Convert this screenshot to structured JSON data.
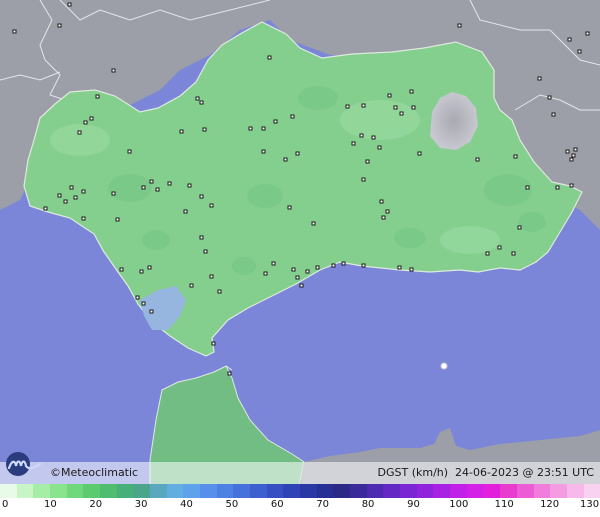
{
  "credit": {
    "symbol": "©",
    "brand": "Meteoclimatic"
  },
  "info": {
    "variable": "DGST",
    "unit": "(km/h)",
    "date": "24-06-2023",
    "sep": "@",
    "time": "23:51 UTC"
  },
  "legend": {
    "ticks": [
      "0",
      "10",
      "20",
      "30",
      "40",
      "50",
      "60",
      "70",
      "80",
      "90",
      "100",
      "110",
      "120",
      "130"
    ],
    "colors": [
      "#e8fbe8",
      "#c8f5c8",
      "#a6eea8",
      "#8ae48e",
      "#6fd87a",
      "#5ccb70",
      "#4fbd70",
      "#47b07a",
      "#4aa58a",
      "#5aa8c0",
      "#62aee0",
      "#5ea2ec",
      "#5690ea",
      "#4f80e4",
      "#4670dc",
      "#3d5fd0",
      "#3650c4",
      "#2f43b6",
      "#2a38a6",
      "#263094",
      "#2a2a86",
      "#3b2a9a",
      "#4e2ab0",
      "#6428c4",
      "#7a26d2",
      "#9024dc",
      "#a822e4",
      "#c020e8",
      "#d41fe6",
      "#e21fdc",
      "#e83ccf",
      "#ec5cd4",
      "#f07ddb",
      "#f49ce2",
      "#f7b8ea",
      "#fad2f1"
    ]
  }
}
